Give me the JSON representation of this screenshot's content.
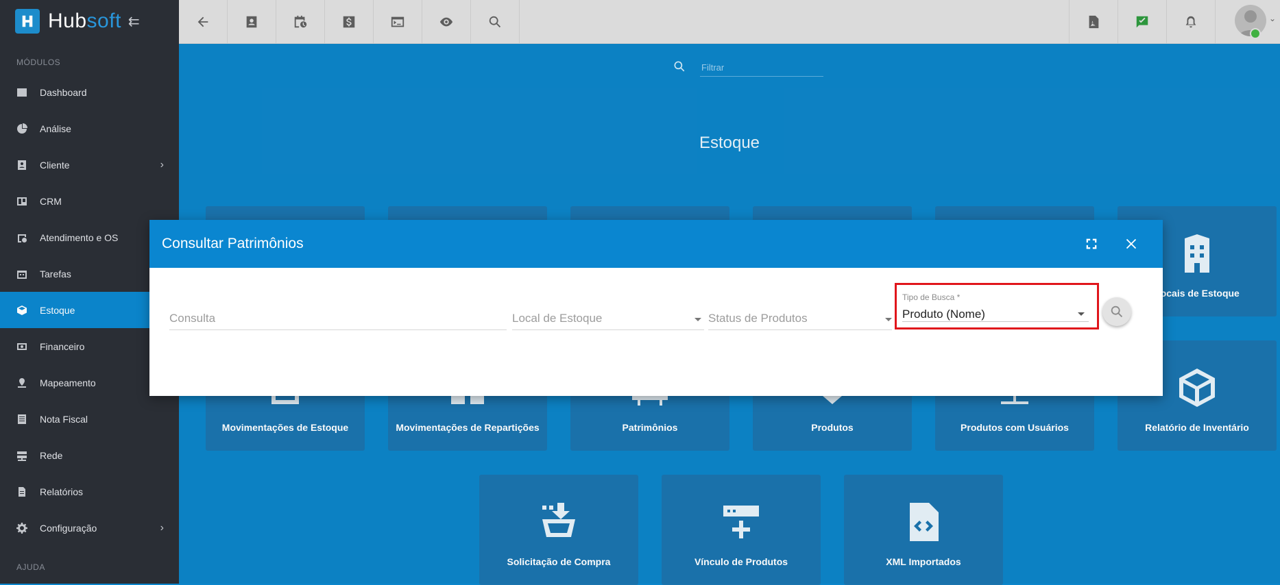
{
  "brand": {
    "name_main": "Hub",
    "name_accent": "soft"
  },
  "sidebar": {
    "section_modules": "MÓDULOS",
    "section_help": "AJUDA",
    "items": [
      {
        "label": "Dashboard",
        "icon": "dashboard-icon"
      },
      {
        "label": "Análise",
        "icon": "pie-chart-icon"
      },
      {
        "label": "Cliente",
        "icon": "contact-card-icon",
        "has_submenu": true
      },
      {
        "label": "CRM",
        "icon": "board-icon"
      },
      {
        "label": "Atendimento e OS",
        "icon": "calendar-clock-icon"
      },
      {
        "label": "Tarefas",
        "icon": "calendar-icon"
      },
      {
        "label": "Estoque",
        "icon": "box-icon",
        "active": true
      },
      {
        "label": "Financeiro",
        "icon": "money-icon"
      },
      {
        "label": "Mapeamento",
        "icon": "map-pin-icon"
      },
      {
        "label": "Nota Fiscal",
        "icon": "document-icon"
      },
      {
        "label": "Rede",
        "icon": "network-icon"
      },
      {
        "label": "Relatórios",
        "icon": "report-icon"
      },
      {
        "label": "Configuração",
        "icon": "gear-icon",
        "has_submenu": true
      }
    ]
  },
  "topbar": {
    "buttons": [
      "back-arrow-icon",
      "contact-icon",
      "calendar-clock-icon",
      "dollar-icon",
      "terminal-icon",
      "eye-icon",
      "search-icon"
    ],
    "right_buttons": [
      "pdf-icon",
      "chat-check-icon",
      "bell-icon"
    ]
  },
  "main": {
    "filter_placeholder": "Filtrar",
    "title": "Estoque",
    "tiles": {
      "locais": "Locais de Estoque",
      "movimentacoes_estoque": "Movimentações de Estoque",
      "movimentacoes_reparticoes": "Movimentações de Repartições",
      "patrimonios": "Patrimônios",
      "produtos": "Produtos",
      "produtos_usuarios": "Produtos com Usuários",
      "relatorio_inventario": "Relatório de Inventário",
      "solicitacao_compra": "Solicitação de Compra",
      "vinculo_produtos": "Vínculo de Produtos",
      "xml_importados": "XML Importados"
    }
  },
  "dialog": {
    "title": "Consultar Patrimônios",
    "fields": {
      "consulta": "Consulta",
      "local_estoque": "Local de Estoque",
      "status_produtos": "Status de Produtos",
      "tipo_busca_label": "Tipo de Busca *",
      "tipo_busca_value": "Produto (Nome)"
    }
  },
  "colors": {
    "accent": "#0a86d0",
    "sidebar_bg": "#2b2f37",
    "highlight": "#e0151b"
  }
}
